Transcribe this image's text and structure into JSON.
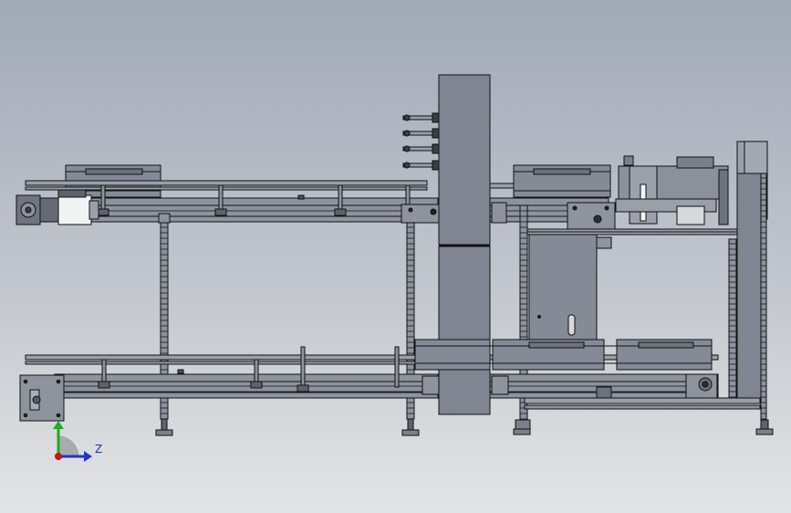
{
  "viewport": {
    "background_top": "#a1a9b7",
    "background_bottom": "#e3e4e5"
  },
  "triad": {
    "axis_label_z": "Z",
    "colors": {
      "z_axis": "#2233cc",
      "y_axis": "#22aa22",
      "origin": "#cc1111"
    }
  },
  "palette": {
    "frame": "#8e949e",
    "frame_dark": "#3a3e48",
    "panel": "#7d838f",
    "line": "#111111"
  }
}
